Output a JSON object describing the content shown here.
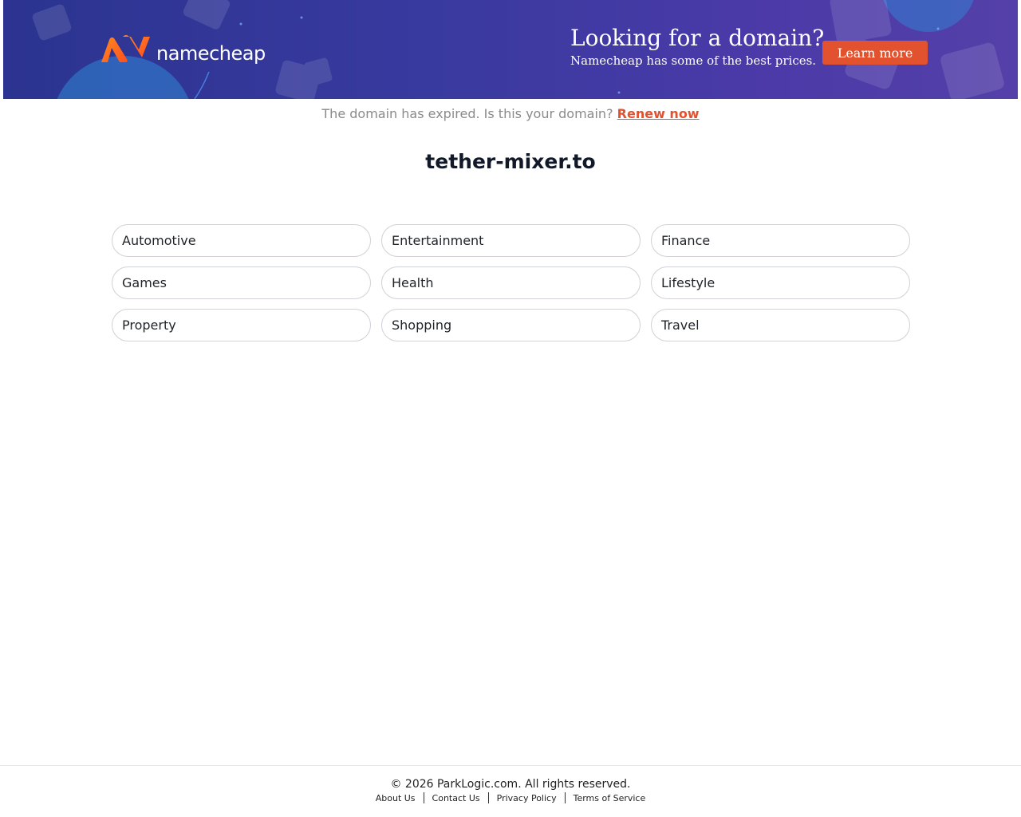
{
  "banner": {
    "logo_text": "namecheap",
    "promo_title": "Looking for a domain?",
    "promo_subtitle": "Namecheap has some of the best prices.",
    "cta_label": "Learn more"
  },
  "notice": {
    "text": "The domain has expired. Is this your domain?",
    "link_label": "Renew now"
  },
  "domain": "tether-mixer.to",
  "categories": [
    "Automotive",
    "Entertainment",
    "Finance",
    "Games",
    "Health",
    "Lifestyle",
    "Property",
    "Shopping",
    "Travel"
  ],
  "footer": {
    "copyright": "© 2026 ParkLogic.com. All rights reserved.",
    "links": [
      "About Us",
      "Contact Us",
      "Privacy Policy",
      "Terms of Service"
    ]
  },
  "colors": {
    "banner_start": "#2b3490",
    "banner_end": "#5440a8",
    "accent": "#e3522f",
    "logo_orange": "#ff6a1f"
  }
}
